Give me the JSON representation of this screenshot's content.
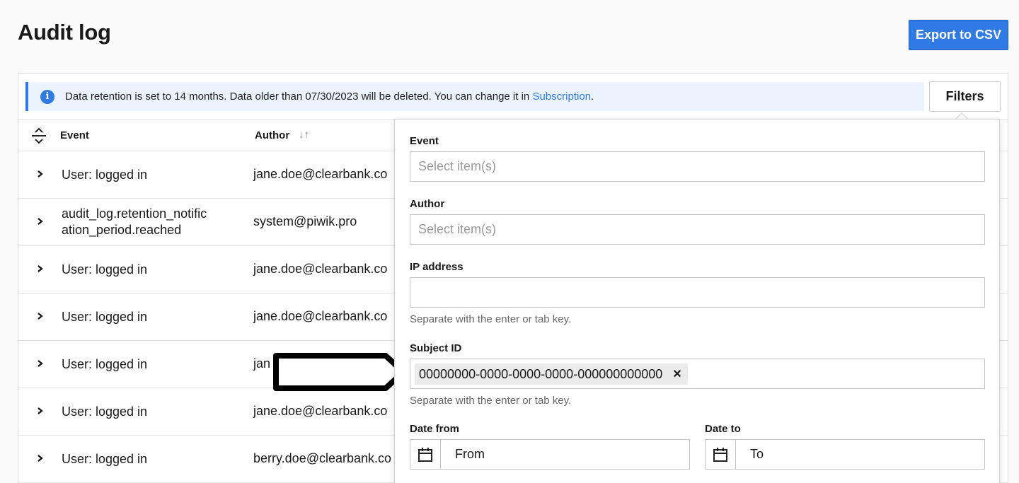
{
  "page": {
    "title": "Audit log"
  },
  "toolbar": {
    "export_label": "Export to CSV"
  },
  "banner": {
    "text": "Data retention is set to 14 months. Data older than 07/30/2023 will be deleted. You can change it in ",
    "link": "Subscription",
    "suffix": "."
  },
  "filters_button": {
    "label": "Filters"
  },
  "table": {
    "columns": {
      "event": "Event",
      "author": "Author"
    },
    "rows": [
      {
        "event": "User: logged in",
        "author": "jane.doe@clearbank.co"
      },
      {
        "event": "audit_log.retention_notific\nation_period.reached",
        "author": "system@piwik.pro"
      },
      {
        "event": "User: logged in",
        "author": "jane.doe@clearbank.co"
      },
      {
        "event": "User: logged in",
        "author": "jane.doe@clearbank.co"
      },
      {
        "event": "User: logged in",
        "author": "jan"
      },
      {
        "event": "User: logged in",
        "author": "jane.doe@clearbank.co"
      },
      {
        "event": "User: logged in",
        "author": "berry.doe@clearbank.co"
      }
    ]
  },
  "filters_panel": {
    "event": {
      "label": "Event",
      "placeholder": "Select item(s)"
    },
    "author": {
      "label": "Author",
      "placeholder": "Select item(s)"
    },
    "ip": {
      "label": "IP address",
      "value": "",
      "hint": "Separate with the enter or tab key."
    },
    "subject": {
      "label": "Subject ID",
      "chip": "00000000-0000-0000-0000-000000000000",
      "hint": "Separate with the enter or tab key."
    },
    "date_from": {
      "label": "Date from",
      "placeholder": "From"
    },
    "date_to": {
      "label": "Date to",
      "placeholder": "To"
    }
  },
  "colors": {
    "accent": "#2f7ae5",
    "banner_bg": "#eaf3fe"
  }
}
